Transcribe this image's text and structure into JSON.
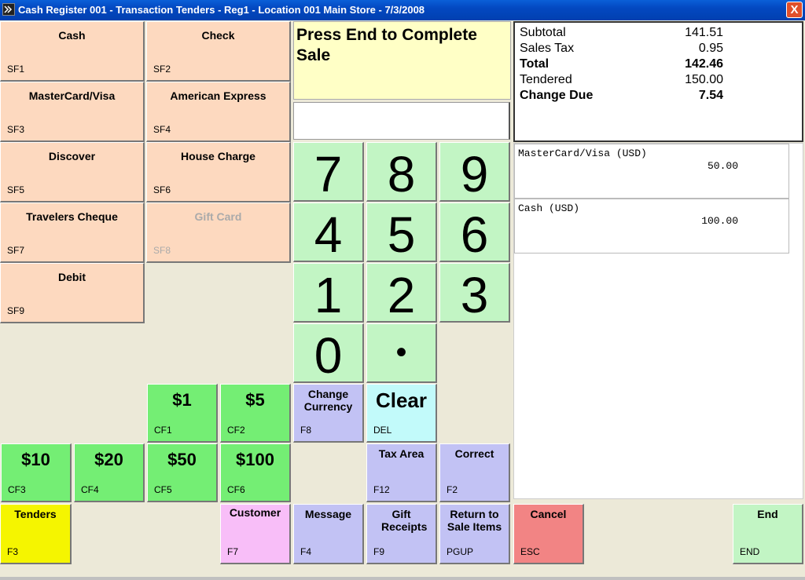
{
  "window": {
    "title": "Cash Register 001 - Transaction Tenders - Reg1 - Location 001 Main Store - 7/3/2008",
    "close_label": "X"
  },
  "tenders": [
    {
      "label": "Cash",
      "key": "SF1"
    },
    {
      "label": "Check",
      "key": "SF2"
    },
    {
      "label": "MasterCard/Visa",
      "key": "SF3"
    },
    {
      "label": "American Express",
      "key": "SF4"
    },
    {
      "label": "Discover",
      "key": "SF5"
    },
    {
      "label": "House Charge",
      "key": "SF6"
    },
    {
      "label": "Travelers Cheque",
      "key": "SF7"
    },
    {
      "label": "Gift Card",
      "key": "SF8"
    },
    {
      "label": "Debit",
      "key": "SF9"
    }
  ],
  "prompt": "Press End to Complete Sale",
  "entry_value": "",
  "keypad": {
    "digits": [
      "7",
      "8",
      "9",
      "4",
      "5",
      "6",
      "1",
      "2",
      "3",
      "0"
    ],
    "decimal": "•"
  },
  "cash_buttons": [
    {
      "label": "$1",
      "key": "CF1"
    },
    {
      "label": "$5",
      "key": "CF2"
    },
    {
      "label": "$10",
      "key": "CF3"
    },
    {
      "label": "$20",
      "key": "CF4"
    },
    {
      "label": "$50",
      "key": "CF5"
    },
    {
      "label": "$100",
      "key": "CF6"
    }
  ],
  "actions": {
    "change_currency": {
      "label": "Change Currency",
      "key": "F8"
    },
    "clear": {
      "label": "Clear",
      "key": "DEL"
    },
    "tax_area": {
      "label": "Tax Area",
      "key": "F12"
    },
    "correct": {
      "label": "Correct",
      "key": "F2"
    },
    "tenders": {
      "label": "Tenders",
      "key": "F3"
    },
    "customer": {
      "label": "Customer",
      "key": "F7"
    },
    "message": {
      "label": "Message",
      "key": "F4"
    },
    "gift_receipts": {
      "label": "Gift Receipts",
      "key": "F9"
    },
    "return_to_sale": {
      "label": "Return to Sale Items",
      "key": "PGUP"
    },
    "cancel": {
      "label": "Cancel",
      "key": "ESC"
    },
    "end": {
      "label": "End",
      "key": "END"
    }
  },
  "summary": {
    "subtotal_label": "Subtotal",
    "subtotal": "141.51",
    "tax_label": "Sales Tax",
    "tax": "0.95",
    "total_label": "Total",
    "total": "142.46",
    "tendered_label": "Tendered",
    "tendered": "150.00",
    "change_label": "Change Due",
    "change": "7.54"
  },
  "tender_list": [
    {
      "name": "MasterCard/Visa (USD)",
      "amount": "50.00"
    },
    {
      "name": "Cash (USD)",
      "amount": "100.00"
    }
  ],
  "colors": {
    "tender": "#fdd9bf",
    "keypad": "#c2f5c4",
    "cash": "#74ee74",
    "action": "#c2c2f4",
    "tenders_active": "#f5f500",
    "customer": "#f8bef8",
    "cancel": "#f28484",
    "clear": "#c2fafa",
    "titlebar": "#0348c0"
  }
}
